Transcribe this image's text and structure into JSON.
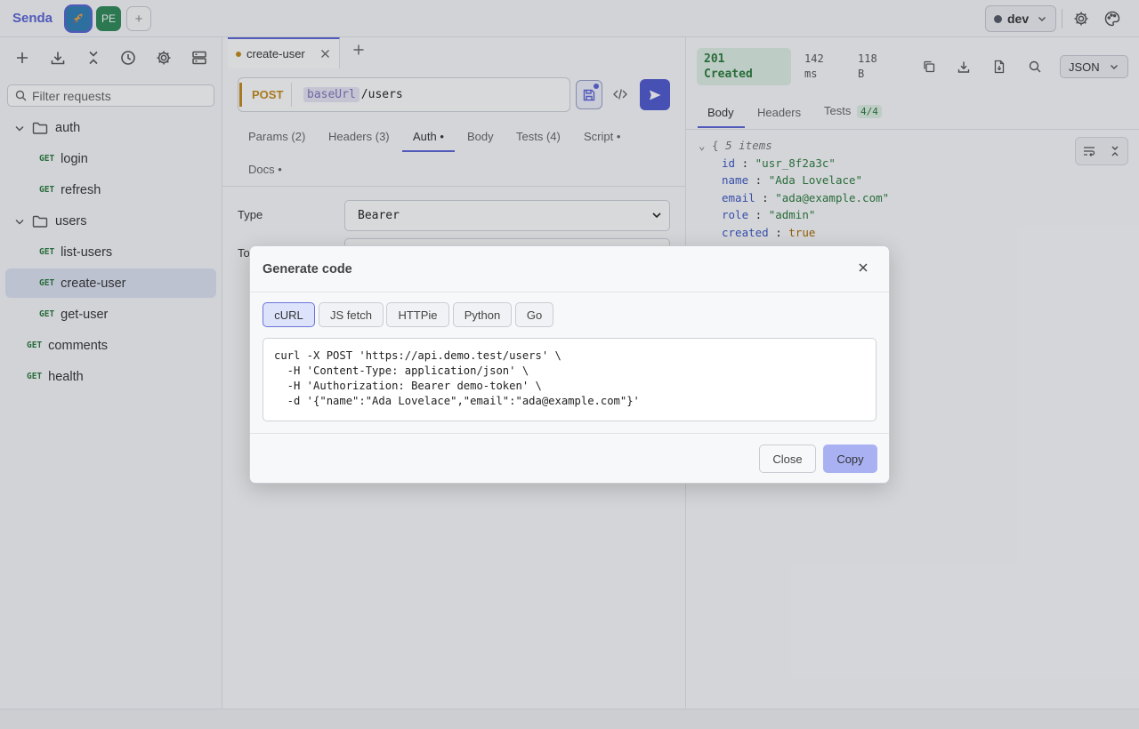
{
  "app": {
    "name": "Senda"
  },
  "workspaces": {
    "current_icon": "rocket-icon",
    "second_label": "PE",
    "add_label": "+"
  },
  "environment": {
    "label": "dev"
  },
  "sidebar": {
    "filter_placeholder": "Filter requests",
    "tree": [
      {
        "type": "folder",
        "label": "auth"
      },
      {
        "type": "request",
        "method": "GET",
        "label": "login"
      },
      {
        "type": "request",
        "method": "GET",
        "label": "refresh"
      },
      {
        "type": "folder",
        "label": "users"
      },
      {
        "type": "request",
        "method": "GET",
        "label": "list-users"
      },
      {
        "type": "request",
        "method": "GET",
        "label": "create-user",
        "selected": true
      },
      {
        "type": "request",
        "method": "GET",
        "label": "get-user"
      },
      {
        "type": "request",
        "method": "GET",
        "label": "comments"
      },
      {
        "type": "request",
        "method": "GET",
        "label": "health"
      }
    ]
  },
  "request": {
    "tab_label": "create-user",
    "method": "POST",
    "url_var": "baseUrl",
    "url_path": "/users",
    "tabs": [
      "Params (2)",
      "Headers (3)",
      "Auth •",
      "Body",
      "Tests (4)",
      "Script •",
      "Docs •"
    ],
    "active_tab": "Auth •",
    "auth": {
      "type_label": "Type",
      "type_value": "Bearer",
      "token_label": "To"
    }
  },
  "response": {
    "status_code": "201",
    "status_text": "Created",
    "time_value": "142",
    "time_unit": "ms",
    "size_value": "118",
    "size_unit": "B",
    "format": "JSON",
    "tabs": {
      "body": "Body",
      "headers": "Headers",
      "tests": "Tests",
      "tests_badge": "4/4"
    },
    "summary": "5 items",
    "fields": [
      {
        "key": "id",
        "value": "\"usr_8f2a3c\""
      },
      {
        "key": "name",
        "value": "\"Ada Lovelace\""
      },
      {
        "key": "email",
        "value": "\"ada@example.com\""
      },
      {
        "key": "role",
        "value": "\"admin\""
      },
      {
        "key": "created",
        "value": "true"
      }
    ]
  },
  "modal": {
    "title": "Generate code",
    "languages": [
      "cURL",
      "JS fetch",
      "HTTPie",
      "Python",
      "Go"
    ],
    "active_language": "cURL",
    "code": "curl -X POST 'https://api.demo.test/users' \\\n  -H 'Content-Type: application/json' \\\n  -H 'Authorization: Bearer demo-token' \\\n  -d '{\"name\":\"Ada Lovelace\",\"email\":\"ada@example.com\"}'",
    "close_label": "Close",
    "copy_label": "Copy"
  }
}
